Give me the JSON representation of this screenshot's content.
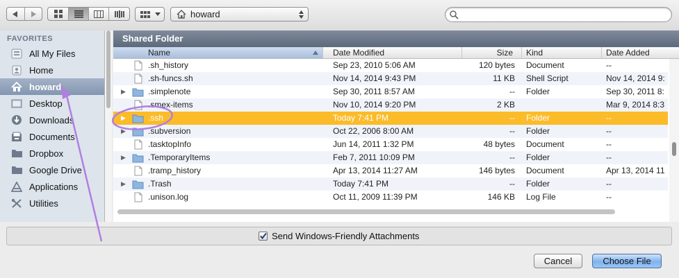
{
  "toolbar": {
    "location": "howard",
    "search_placeholder": ""
  },
  "sidebar": {
    "section_label": "FAVORITES",
    "items": [
      {
        "label": "All My Files",
        "icon": "all-files-icon"
      },
      {
        "label": "Home",
        "icon": "home-icon"
      },
      {
        "label": "howard",
        "icon": "house-icon",
        "selected": true
      },
      {
        "label": "Desktop",
        "icon": "desktop-icon"
      },
      {
        "label": "Downloads",
        "icon": "downloads-icon"
      },
      {
        "label": "Documents",
        "icon": "documents-icon"
      },
      {
        "label": "Dropbox",
        "icon": "folder-icon"
      },
      {
        "label": "Google Drive",
        "icon": "folder-icon"
      },
      {
        "label": "Applications",
        "icon": "applications-icon"
      },
      {
        "label": "Utilities",
        "icon": "utilities-icon"
      }
    ]
  },
  "browser": {
    "path_title": "Shared Folder",
    "columns": [
      "Name",
      "Date Modified",
      "Size",
      "Kind",
      "Date Added"
    ],
    "rows": [
      {
        "name": ".sh_history",
        "modified": "Sep 23, 2010 5:06 AM",
        "size": "120 bytes",
        "kind": "Document",
        "added": "--",
        "type": "file"
      },
      {
        "name": ".sh-funcs.sh",
        "modified": "Nov 14, 2014 9:43 PM",
        "size": "11 KB",
        "kind": "Shell Script",
        "added": "Nov 14, 2014 9:",
        "type": "file"
      },
      {
        "name": ".simplenote",
        "modified": "Sep 30, 2011 8:57 AM",
        "size": "--",
        "kind": "Folder",
        "added": "Sep 30, 2011 8:",
        "type": "folder"
      },
      {
        "name": ".smex-items",
        "modified": "Nov 10, 2014 9:20 PM",
        "size": "2 KB",
        "kind": "",
        "added": "Mar 9, 2014 8:3",
        "type": "file"
      },
      {
        "name": ".ssh",
        "modified": "Today 7:41 PM",
        "size": "--",
        "kind": "Folder",
        "added": "--",
        "type": "folder",
        "selected": true
      },
      {
        "name": ".subversion",
        "modified": "Oct 22, 2006 8:00 AM",
        "size": "--",
        "kind": "Folder",
        "added": "--",
        "type": "folder"
      },
      {
        "name": ".tasktopInfo",
        "modified": "Jun 14, 2011 1:32 PM",
        "size": "48 bytes",
        "kind": "Document",
        "added": "--",
        "type": "file"
      },
      {
        "name": ".TemporaryItems",
        "modified": "Feb 7, 2011 10:09 PM",
        "size": "--",
        "kind": "Folder",
        "added": "--",
        "type": "folder"
      },
      {
        "name": ".tramp_history",
        "modified": "Apr 13, 2014 11:27 AM",
        "size": "146 bytes",
        "kind": "Document",
        "added": "Apr 13, 2014 11",
        "type": "file"
      },
      {
        "name": ".Trash",
        "modified": "Today 7:41 PM",
        "size": "--",
        "kind": "Folder",
        "added": "--",
        "type": "folder"
      },
      {
        "name": ".unison.log",
        "modified": "Oct 11, 2009 11:39 PM",
        "size": "146 KB",
        "kind": "Log File",
        "added": "--",
        "type": "file"
      }
    ]
  },
  "options": {
    "checkbox_label": "Send Windows-Friendly Attachments",
    "checked": true
  },
  "buttons": {
    "cancel": "Cancel",
    "choose": "Choose File"
  },
  "colors": {
    "selection": "#fcbb29",
    "annotation": "#b07fe0",
    "sidebar_bg": "#dde4ec"
  }
}
